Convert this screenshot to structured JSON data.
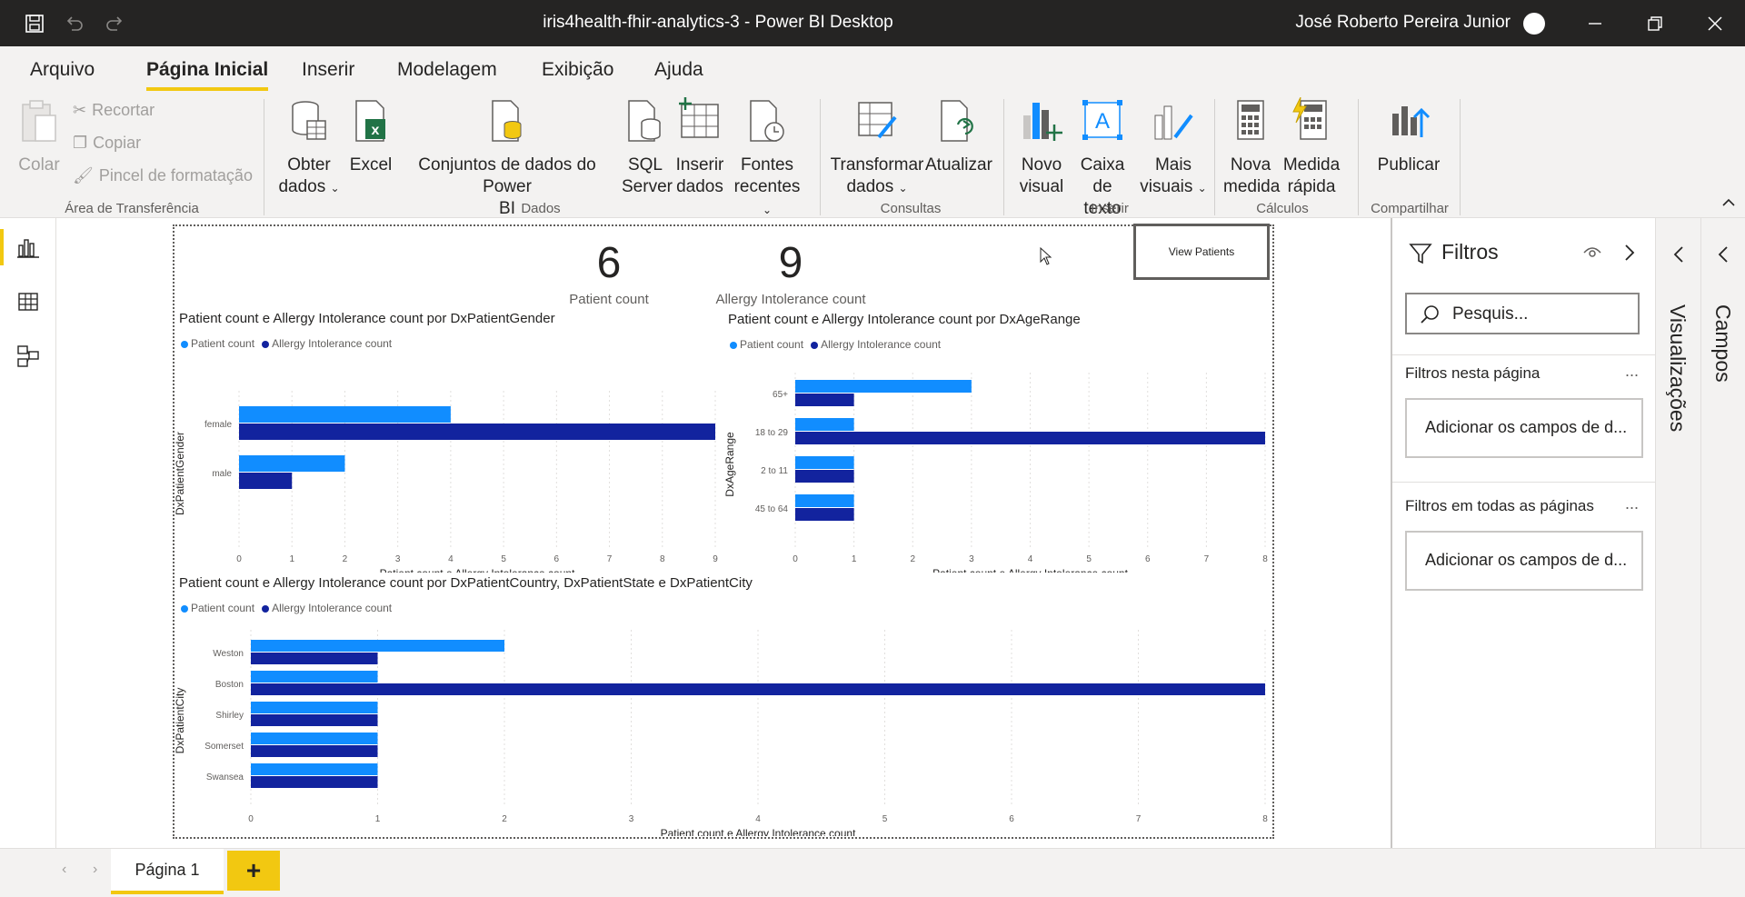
{
  "titlebar": {
    "title": "iris4health-fhir-analytics-3 - Power BI Desktop",
    "user": "José Roberto Pereira Junior"
  },
  "tabs": [
    "Arquivo",
    "Página Inicial",
    "Inserir",
    "Modelagem",
    "Exibição",
    "Ajuda"
  ],
  "ribbon": {
    "clipboard": {
      "paste": "Colar",
      "cut": "Recortar",
      "copy": "Copiar",
      "format_painter": "Pincel de formatação",
      "group": "Área de Transferência"
    },
    "data": {
      "get_data": [
        "Obter",
        "dados"
      ],
      "excel": "Excel",
      "datasets": [
        "Conjuntos de dados do Power",
        "BI"
      ],
      "sql": [
        "SQL",
        "Server"
      ],
      "enter_data": [
        "Inserir",
        "dados"
      ],
      "recent": [
        "Fontes",
        "recentes"
      ],
      "group": "Dados"
    },
    "queries": {
      "transform": [
        "Transformar",
        "dados"
      ],
      "refresh": "Atualizar",
      "group": "Consultas"
    },
    "insert": {
      "new_visual": [
        "Novo",
        "visual"
      ],
      "text_box": [
        "Caixa de",
        "texto"
      ],
      "more_visuals": [
        "Mais",
        "visuais"
      ],
      "group": "Inserir"
    },
    "calculations": {
      "new_measure": [
        "Nova",
        "medida"
      ],
      "quick_measure": [
        "Medida",
        "rápida"
      ],
      "group": "Cálculos"
    },
    "share": {
      "publish": "Publicar",
      "group": "Compartilhar"
    }
  },
  "kpis": [
    {
      "value": "6",
      "label": "Patient count"
    },
    {
      "value": "9",
      "label": "Allergy Intolerance count"
    }
  ],
  "view_button": "View Patients",
  "legend": [
    "Patient count",
    "Allergy Intolerance count"
  ],
  "colors": {
    "patient": "#118dff",
    "allergy": "#12239e",
    "accent": "#f2c811"
  },
  "chart_data": [
    {
      "type": "bar",
      "orientation": "horizontal",
      "title": "Patient count e Allergy Intolerance count por DxPatientGender",
      "xlabel": "Patient count e Allergy Intolerance count",
      "ylabel": "DxPatientGender",
      "categories": [
        "female",
        "male"
      ],
      "series": [
        {
          "name": "Patient count",
          "values": [
            4,
            2
          ]
        },
        {
          "name": "Allergy Intolerance count",
          "values": [
            9,
            1
          ]
        }
      ],
      "xlim": [
        0,
        9
      ],
      "xticks": [
        "0",
        "1",
        "2",
        "3",
        "4",
        "5",
        "6",
        "7",
        "8",
        "9"
      ]
    },
    {
      "type": "bar",
      "orientation": "horizontal",
      "title": "Patient count e Allergy Intolerance count por DxAgeRange",
      "xlabel": "Patient count e Allergy Intolerance count",
      "ylabel": "DxAgeRange",
      "categories": [
        "65+",
        "18 to 29",
        "2 to 11",
        "45 to 64"
      ],
      "series": [
        {
          "name": "Patient count",
          "values": [
            3,
            1,
            1,
            1
          ]
        },
        {
          "name": "Allergy Intolerance count",
          "values": [
            1,
            8,
            1,
            1
          ]
        }
      ],
      "xlim": [
        0,
        8
      ],
      "xticks": [
        "0",
        "1",
        "2",
        "3",
        "4",
        "5",
        "6",
        "7",
        "8"
      ]
    },
    {
      "type": "bar",
      "orientation": "horizontal",
      "title": "Patient count e Allergy Intolerance count por DxPatientCountry, DxPatientState e DxPatientCity",
      "xlabel": "Patient count e Allergy Intolerance count",
      "ylabel": "DxPatientCity",
      "categories": [
        "Weston",
        "Boston",
        "Shirley",
        "Somerset",
        "Swansea"
      ],
      "series": [
        {
          "name": "Patient count",
          "values": [
            2,
            1,
            1,
            1,
            1
          ]
        },
        {
          "name": "Allergy Intolerance count",
          "values": [
            1,
            8,
            1,
            1,
            1
          ]
        }
      ],
      "xlim": [
        0,
        8
      ],
      "xticks": [
        "0",
        "1",
        "2",
        "3",
        "4",
        "5",
        "6",
        "7",
        "8"
      ]
    }
  ],
  "filters": {
    "title": "Filtros",
    "search_placeholder": "Pesquis...",
    "page_filters": "Filtros nesta página",
    "all_filters": "Filtros em todas as páginas",
    "add_fields": "Adicionar os campos de d...",
    "more": "..."
  },
  "panes": {
    "visualizations": "Visualizações",
    "fields": "Campos"
  },
  "page_tab": "Página 1",
  "add_page": "+"
}
